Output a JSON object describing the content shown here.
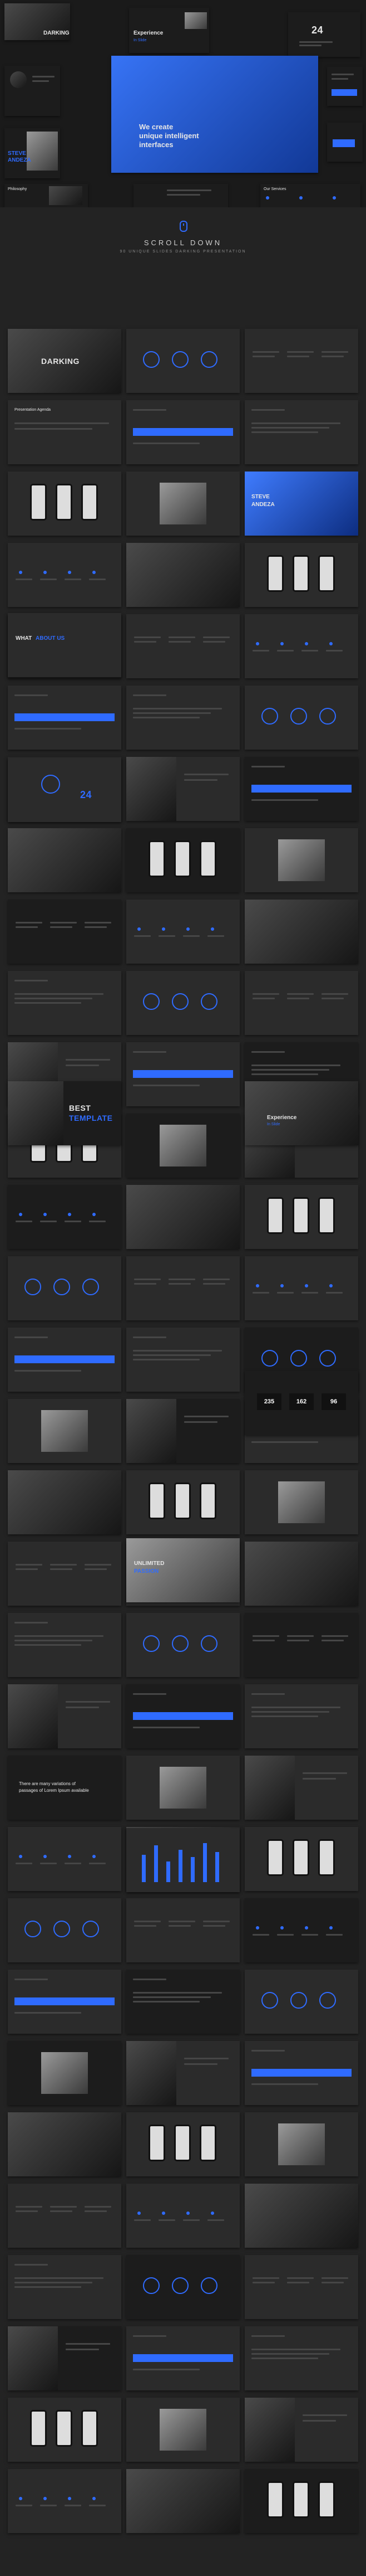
{
  "hero": {
    "slide_texts": {
      "darking_logo": "DARKING",
      "experience": "Experience",
      "experience_sub": "In Slide",
      "number_24": "24",
      "tagline_line1": "We create",
      "tagline_line2": "unique intelligent",
      "tagline_line3": "interfaces",
      "steve_name_1": "STEVE",
      "steve_name_2": "ANDEZA",
      "philosophy": "Philosophy",
      "our_services": "Our Services"
    }
  },
  "scroll": {
    "title": "SCROLL DOWN",
    "subtitle": "90 UNIQUE SLIDES DARKING PRESENTATION"
  },
  "slides": {
    "darking_title": "DARKING",
    "presentation_agenda": "Presentation Agenda",
    "steve_1": "STEVE",
    "steve_2": "ANDEZA",
    "what_word": "WHAT",
    "about_us": "ABOUT US",
    "number_24": "24",
    "best_word": "BEST",
    "template_word": "TEMPLATE",
    "experience": "Experience",
    "experience_sub": "In Slide",
    "stat_1": "235",
    "stat_2": "162",
    "stat_3": "96",
    "welcome_line1": "There are many variations of",
    "welcome_line2": "passages of Lorem Ipsum available",
    "eiffel_1": "UNLIMITED",
    "eiffel_2": "PASSION"
  },
  "chart_bars": [
    60,
    80,
    45,
    70,
    55,
    85,
    65
  ]
}
